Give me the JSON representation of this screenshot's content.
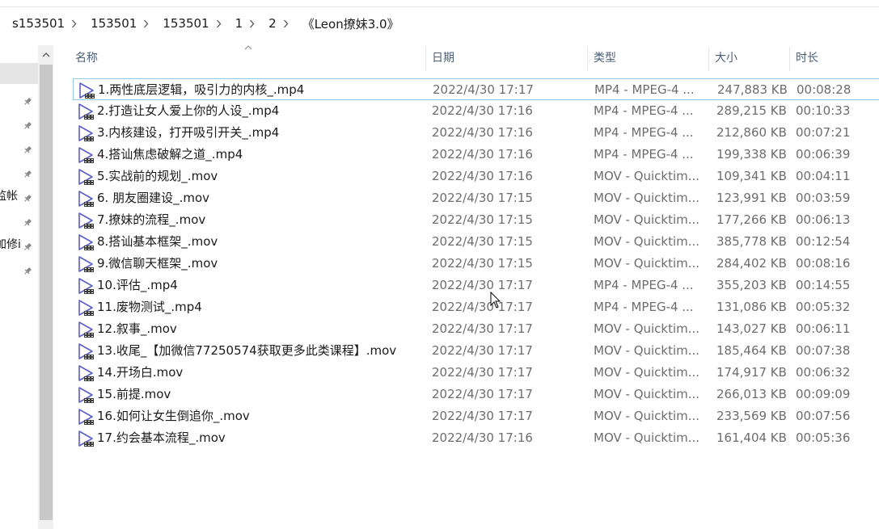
{
  "breadcrumb": [
    "s153501",
    "153501",
    "153501",
    "1",
    "2",
    "《Leon撩妹3.0》"
  ],
  "nav": {
    "labels": [
      "监帐",
      "加修i"
    ]
  },
  "columns": {
    "name": "名称",
    "date": "日期",
    "type": "类型",
    "size": "大小",
    "duration": "时长"
  },
  "files": [
    {
      "name": "1.两性底层逻辑，吸引力的内核_.mp4",
      "date": "2022/4/30 17:17",
      "type": "MP4 - MPEG-4 ...",
      "size": "247,883 KB",
      "duration": "00:08:28"
    },
    {
      "name": "2.打造让女人爱上你的人设_.mp4",
      "date": "2022/4/30 17:16",
      "type": "MP4 - MPEG-4 ...",
      "size": "289,215 KB",
      "duration": "00:10:33"
    },
    {
      "name": "3.内核建设，打开吸引开关_.mp4",
      "date": "2022/4/30 17:16",
      "type": "MP4 - MPEG-4 ...",
      "size": "212,860 KB",
      "duration": "00:07:21"
    },
    {
      "name": "4.搭讪焦虑破解之道_.mp4",
      "date": "2022/4/30 17:16",
      "type": "MP4 - MPEG-4 ...",
      "size": "199,338 KB",
      "duration": "00:06:39"
    },
    {
      "name": "5.实战前的规划_.mov",
      "date": "2022/4/30 17:16",
      "type": "MOV - Quicktim...",
      "size": "109,341 KB",
      "duration": "00:04:11"
    },
    {
      "name": "6. 朋友圈建设_.mov",
      "date": "2022/4/30 17:15",
      "type": "MOV - Quicktim...",
      "size": "123,991 KB",
      "duration": "00:03:59"
    },
    {
      "name": "7.撩妹的流程_.mov",
      "date": "2022/4/30 17:15",
      "type": "MOV - Quicktim...",
      "size": "177,266 KB",
      "duration": "00:06:13"
    },
    {
      "name": "8.搭讪基本框架_.mov",
      "date": "2022/4/30 17:15",
      "type": "MOV - Quicktim...",
      "size": "385,778 KB",
      "duration": "00:12:54"
    },
    {
      "name": "9.微信聊天框架_.mov",
      "date": "2022/4/30 17:15",
      "type": "MOV - Quicktim...",
      "size": "284,402 KB",
      "duration": "00:08:16"
    },
    {
      "name": "10.评估_.mp4",
      "date": "2022/4/30 17:17",
      "type": "MP4 - MPEG-4 ...",
      "size": "355,203 KB",
      "duration": "00:14:55"
    },
    {
      "name": "11.废物测试_.mp4",
      "date": "2022/4/30 17:17",
      "type": "MP4 - MPEG-4 ...",
      "size": "131,086 KB",
      "duration": "00:05:32"
    },
    {
      "name": "12.叙事_.mov",
      "date": "2022/4/30 17:17",
      "type": "MOV - Quicktim...",
      "size": "143,027 KB",
      "duration": "00:06:11"
    },
    {
      "name": "13.收尾_【加微信77250574获取更多此类课程】.mov",
      "date": "2022/4/30 17:17",
      "type": "MOV - Quicktim...",
      "size": "185,464 KB",
      "duration": "00:07:38"
    },
    {
      "name": "14.开场白.mov",
      "date": "2022/4/30 17:17",
      "type": "MOV - Quicktim...",
      "size": "174,917 KB",
      "duration": "00:06:32"
    },
    {
      "name": "15.前提.mov",
      "date": "2022/4/30 17:17",
      "type": "MOV - Quicktim...",
      "size": "266,013 KB",
      "duration": "00:09:09"
    },
    {
      "name": "16.如何让女生倒追你_.mov",
      "date": "2022/4/30 17:17",
      "type": "MOV - Quicktim...",
      "size": "233,569 KB",
      "duration": "00:07:56"
    },
    {
      "name": "17.约会基本流程_.mov",
      "date": "2022/4/30 17:16",
      "type": "MOV - Quicktim...",
      "size": "161,404 KB",
      "duration": "00:05:36"
    }
  ],
  "colors": {
    "header_text": "#4c607a",
    "icon": "#5b5fc7",
    "focus_border": "#99c9ef"
  }
}
